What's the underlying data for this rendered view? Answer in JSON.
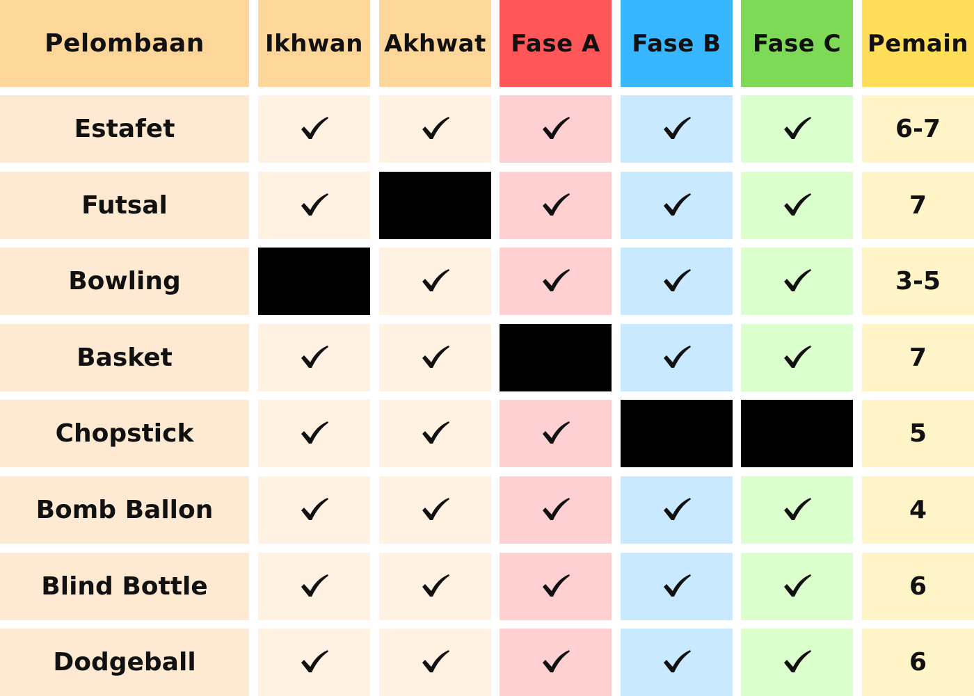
{
  "colors": {
    "white": "#ffffff",
    "col_bg": {
      "pelombaan": {
        "head": "#fdd69a",
        "body": "#feead2"
      },
      "ikhwan": {
        "head": "#fdd69a",
        "body": "#fff2e3"
      },
      "akhwat": {
        "head": "#fdd69a",
        "body": "#fff2e3"
      },
      "fase_a": {
        "head": "#ff5757",
        "body": "#ffd0d1"
      },
      "fase_b": {
        "head": "#38b6ff",
        "body": "#c8e9ff"
      },
      "fase_c": {
        "head": "#7ed957",
        "body": "#dbffcc"
      },
      "pemain": {
        "head": "#ffde59",
        "body": "#fff4c7"
      }
    },
    "blank": "#000000"
  },
  "table": {
    "columns": [
      {
        "key": "pelombaan",
        "label": "Pelombaan"
      },
      {
        "key": "ikhwan",
        "label": "Ikhwan"
      },
      {
        "key": "akhwat",
        "label": "Akhwat"
      },
      {
        "key": "fase_a",
        "label": "Fase A"
      },
      {
        "key": "fase_b",
        "label": "Fase B"
      },
      {
        "key": "fase_c",
        "label": "Fase C"
      },
      {
        "key": "pemain",
        "label": "Pemain"
      }
    ],
    "rows": [
      {
        "name": "Estafet",
        "cells": [
          "check",
          "check",
          "check",
          "check",
          "check"
        ],
        "pemain": "6-7"
      },
      {
        "name": "Futsal",
        "cells": [
          "check",
          "blank",
          "check",
          "check",
          "check"
        ],
        "pemain": "7"
      },
      {
        "name": "Bowling",
        "cells": [
          "blank",
          "check",
          "check",
          "check",
          "check"
        ],
        "pemain": "3-5"
      },
      {
        "name": "Basket",
        "cells": [
          "check",
          "check",
          "blank",
          "check",
          "check"
        ],
        "pemain": "7"
      },
      {
        "name": "Chopstick",
        "cells": [
          "check",
          "check",
          "check",
          "blank",
          "blank"
        ],
        "pemain": "5"
      },
      {
        "name": "Bomb Ballon",
        "cells": [
          "check",
          "check",
          "check",
          "check",
          "check"
        ],
        "pemain": "4"
      },
      {
        "name": "Blind Bottle",
        "cells": [
          "check",
          "check",
          "check",
          "check",
          "check"
        ],
        "pemain": "6"
      },
      {
        "name": "Dodgeball",
        "cells": [
          "check",
          "check",
          "check",
          "check",
          "check"
        ],
        "pemain": "6"
      }
    ]
  }
}
